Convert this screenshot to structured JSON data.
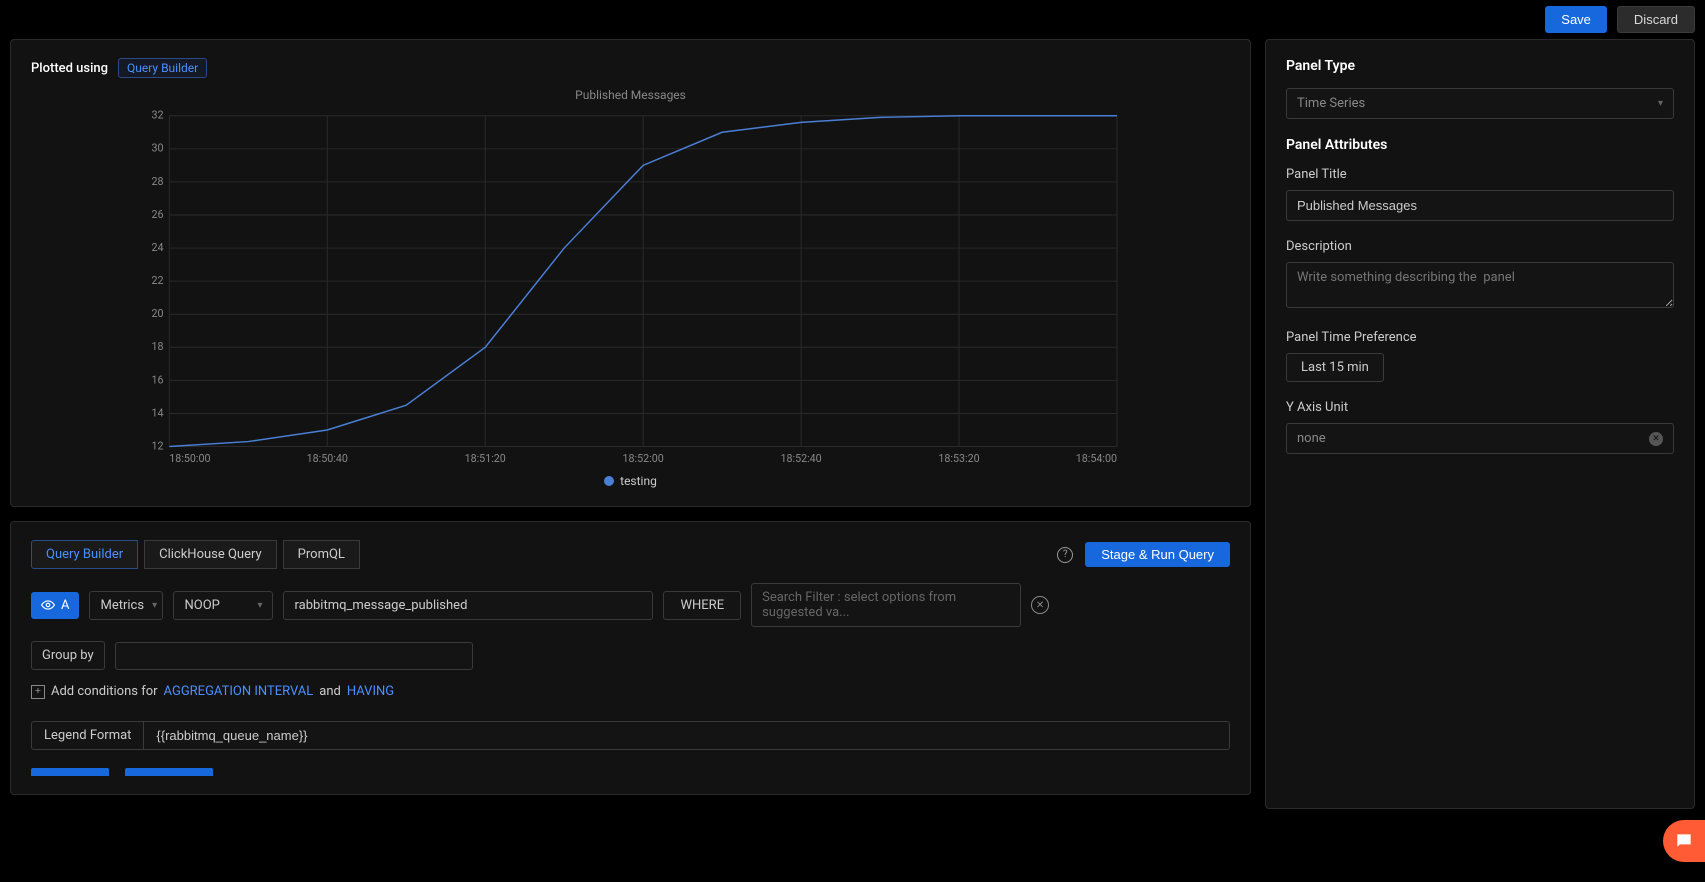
{
  "topbar": {
    "save": "Save",
    "discard": "Discard"
  },
  "chart_panel": {
    "plotted_using": "Plotted using",
    "badge": "Query Builder"
  },
  "chart_data": {
    "type": "line",
    "title": "Published Messages",
    "xlabel": "",
    "ylabel": "",
    "ylim": [
      12,
      32
    ],
    "y_ticks": [
      12,
      14,
      16,
      18,
      20,
      22,
      24,
      26,
      28,
      30,
      32
    ],
    "x_ticks": [
      "18:50:00",
      "18:50:40",
      "18:51:20",
      "18:52:00",
      "18:52:40",
      "18:53:20",
      "18:54:00"
    ],
    "series": [
      {
        "name": "testing",
        "color": "#4a7fd6",
        "x": [
          "18:50:00",
          "18:50:20",
          "18:50:40",
          "18:51:00",
          "18:51:20",
          "18:51:40",
          "18:52:00",
          "18:52:20",
          "18:52:40",
          "18:53:00",
          "18:53:20",
          "18:53:40",
          "18:54:00"
        ],
        "values": [
          12.0,
          12.3,
          13.0,
          14.5,
          18.0,
          24.0,
          29.0,
          31.0,
          31.6,
          31.9,
          32.0,
          32.0,
          32.0
        ]
      }
    ]
  },
  "query": {
    "tabs": [
      "Query Builder",
      "ClickHouse Query",
      "PromQL"
    ],
    "active_tab": 0,
    "run_button": "Stage & Run Query",
    "series_letter": "A",
    "metric_mode": "Metrics",
    "aggregation": "NOOP",
    "metric_name": "rabbitmq_message_published",
    "where_label": "WHERE",
    "filter_placeholder": "Search Filter : select options from suggested va...",
    "groupby_label": "Group by",
    "add_cond_prefix": "Add conditions for",
    "agg_interval": "AGGREGATION INTERVAL",
    "and_text": "and",
    "having": "HAVING",
    "legend_format_label": "Legend Format",
    "legend_format_value": "{{rabbitmq_queue_name}}"
  },
  "sidebar": {
    "panel_type_heading": "Panel Type",
    "panel_type_value": "Time Series",
    "attributes_heading": "Panel Attributes",
    "title_label": "Panel Title",
    "title_value": "Published Messages",
    "description_label": "Description",
    "description_placeholder": "Write something describing the  panel",
    "time_pref_label": "Panel Time Preference",
    "time_pref_value": "Last 15 min",
    "y_unit_label": "Y Axis Unit",
    "y_unit_value": "none"
  }
}
